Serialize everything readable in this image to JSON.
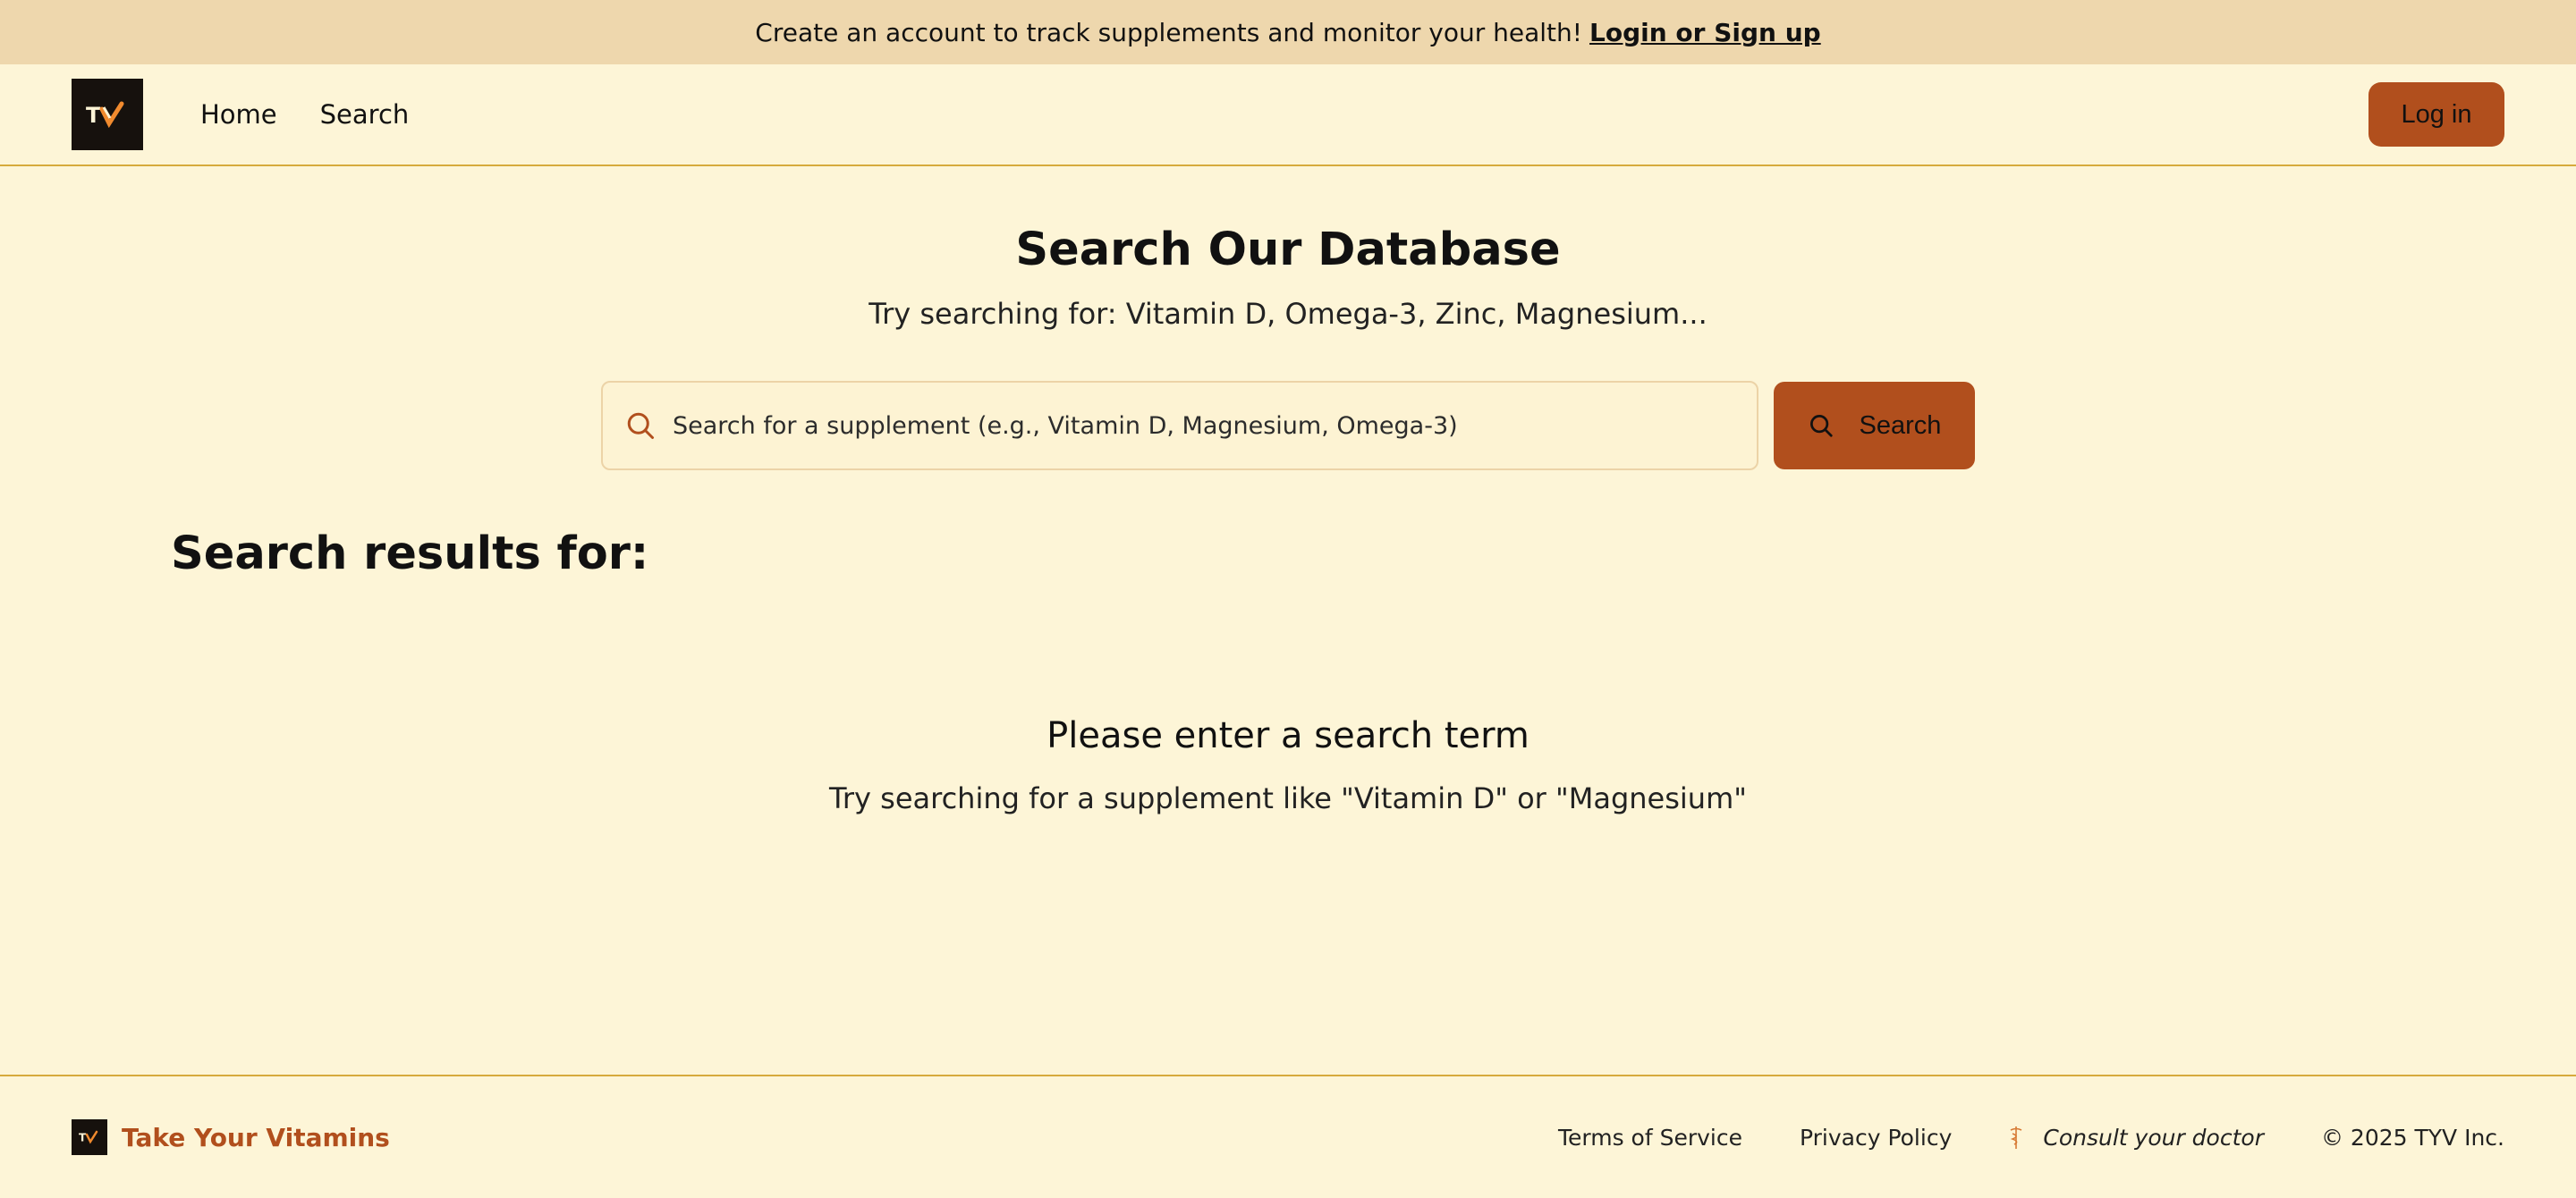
{
  "banner": {
    "text": "Create an account to track supplements and monitor your health!",
    "link": "Login or Sign up"
  },
  "nav": {
    "logo_text": "TYV",
    "links": [
      "Home",
      "Search"
    ],
    "login_label": "Log in"
  },
  "main": {
    "title": "Search Our Database",
    "subtitle": "Try searching for: Vitamin D, Omega-3, Zinc, Magnesium...",
    "search_placeholder": "Search for a supplement (e.g., Vitamin D, Magnesium, Omega-3)",
    "search_value": "",
    "search_button": "Search",
    "results_heading": "Search results for:",
    "empty_title": "Please enter a search term",
    "empty_text": "Try searching for a supplement like \"Vitamin D\" or \"Magnesium\""
  },
  "footer": {
    "brand": "Take Your Vitamins",
    "links": [
      "Terms of Service",
      "Privacy Policy"
    ],
    "consult": "Consult your doctor",
    "copyright": "© 2025 TYV Inc."
  },
  "colors": {
    "background": "#fdf5d7",
    "banner": "#eed7ad",
    "accent": "#b14f1d",
    "border": "#d6aa3c"
  },
  "icons": [
    "search-icon",
    "caduceus-icon"
  ]
}
